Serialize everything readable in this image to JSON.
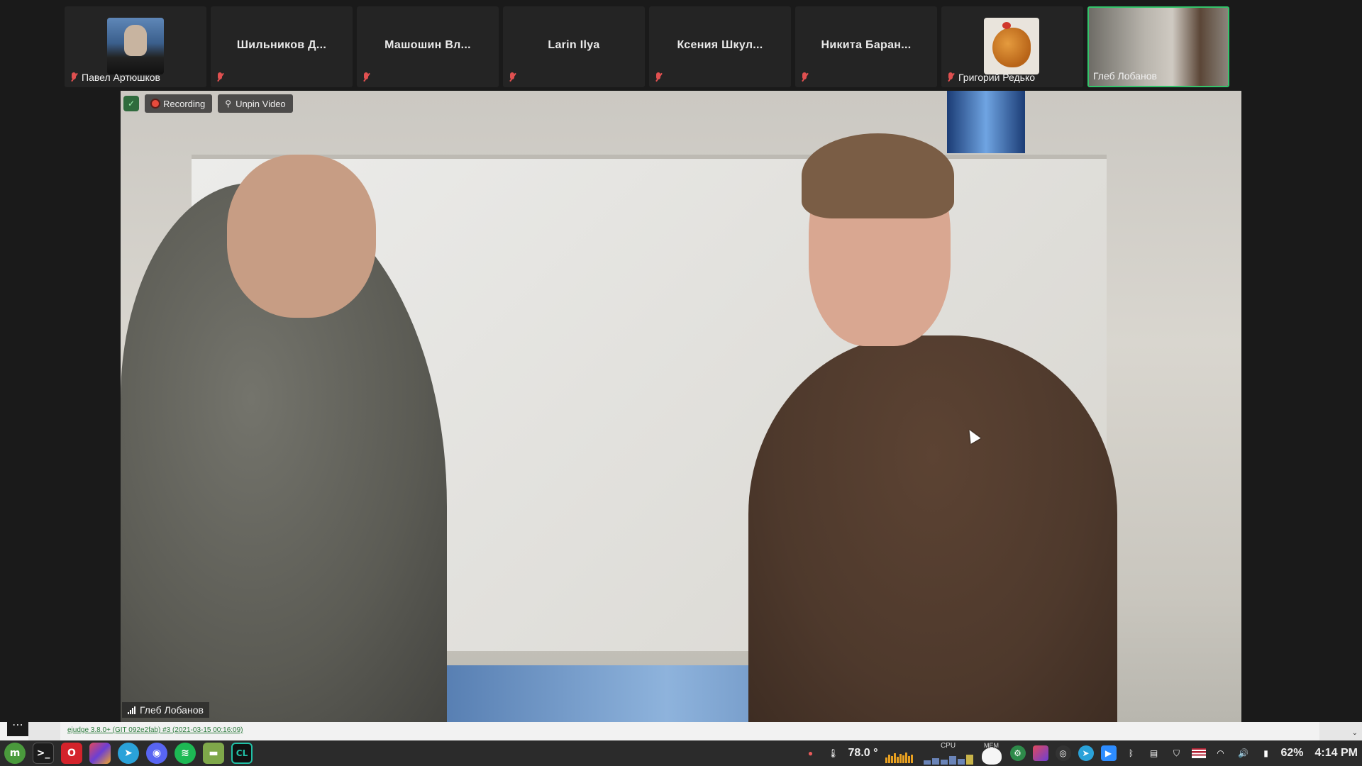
{
  "participants": [
    {
      "name": "Павел Артюшков",
      "label_position": "bottom",
      "avatar": "hero-avatar",
      "muted": true
    },
    {
      "name": "Шильников Д...",
      "label_position": "center",
      "muted": true
    },
    {
      "name": "Машошин Вл...",
      "label_position": "center",
      "muted": true
    },
    {
      "name": "Larin Ilya",
      "label_position": "center",
      "muted": true
    },
    {
      "name": "Ксения Шкул...",
      "label_position": "center",
      "muted": true
    },
    {
      "name": "Никита Баран...",
      "label_position": "center",
      "muted": true
    },
    {
      "name": "Григорий Редько",
      "label_position": "bottom",
      "avatar": "chicken-avatar",
      "muted": true
    },
    {
      "name": "Глеб Лобанов",
      "label_position": "bottom",
      "video": true,
      "active_speaker": true,
      "muted": false
    }
  ],
  "meeting": {
    "recording_label": "Recording",
    "unpin_label": "Unpin Video",
    "speaker_name": "Глеб Лобанов"
  },
  "browser": {
    "dots": "⋯",
    "footer_link": "ejudge 3.8.0+ (GIT 092e2fab) #3 (2021-03-15 00:16:09)",
    "scroll_glyph": "⌄"
  },
  "taskbar": {
    "apps": [
      {
        "name": "mint-menu-icon",
        "glyph": "m",
        "color": "#4a9a3c"
      },
      {
        "name": "terminal-icon",
        "glyph": ">_",
        "color": "#1c1c1c"
      },
      {
        "name": "opera-icon",
        "glyph": "O",
        "color": "#d4232b"
      },
      {
        "name": "jetbrains-toolbox-icon",
        "glyph": "■",
        "color": "#e2495c"
      },
      {
        "name": "telegram-icon",
        "glyph": "➤",
        "color": "#2aa2d9"
      },
      {
        "name": "discord-icon",
        "glyph": "◉",
        "color": "#5865f2"
      },
      {
        "name": "spotify-icon",
        "glyph": "≋",
        "color": "#1db954"
      },
      {
        "name": "files-icon",
        "glyph": "▬",
        "color": "#7fa84a"
      },
      {
        "name": "clion-icon",
        "glyph": "CL",
        "color": "#21c0a6"
      }
    ],
    "temperature": "78.0 °",
    "cpu_label": "CPU",
    "mem_label": "MEM",
    "battery": "62%",
    "time": "4:14 PM"
  }
}
